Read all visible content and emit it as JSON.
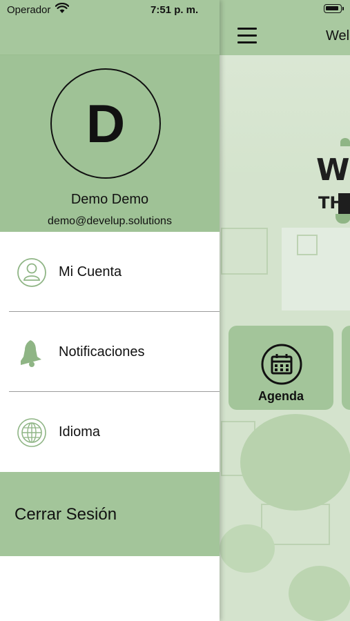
{
  "status_bar": {
    "carrier": "Operador",
    "time": "7:51 p. m."
  },
  "profile": {
    "initial": "D",
    "name": "Demo Demo",
    "email": "demo@develup.solutions"
  },
  "menu": {
    "items": [
      {
        "label": "Mi Cuenta",
        "icon": "user-icon"
      },
      {
        "label": "Notificaciones",
        "icon": "bell-icon"
      },
      {
        "label": "Idioma",
        "icon": "globe-icon"
      }
    ],
    "logout_label": "Cerrar Sesión"
  },
  "main": {
    "title": "Wel",
    "logo_text_1": "W",
    "logo_text_2": "THE",
    "tiles": [
      {
        "label": "Agenda",
        "icon": "calendar-icon"
      }
    ]
  },
  "colors": {
    "drawer_green": "#a6c79d",
    "tile_green": "#a3c59a",
    "icon_green": "#8fb585"
  }
}
